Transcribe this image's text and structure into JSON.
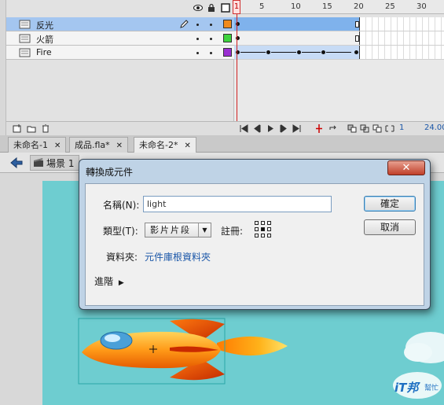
{
  "timeline": {
    "frame_numbers": [
      "1",
      "5",
      "10",
      "15",
      "20",
      "25",
      "30"
    ],
    "layers": [
      {
        "name": "反光",
        "color": "#f08a1c",
        "selected": true
      },
      {
        "name": "火箭",
        "color": "#3ed33e",
        "selected": false
      },
      {
        "name": "Fire",
        "color": "#9a2fd2",
        "selected": false
      }
    ],
    "current_frame": "1",
    "fps": "24.00"
  },
  "tabs": [
    {
      "label": "未命名-1",
      "active": false
    },
    {
      "label": "成品.fla*",
      "active": false
    },
    {
      "label": "未命名-2*",
      "active": true
    }
  ],
  "edit_bar": {
    "scene_label": "場景 1"
  },
  "dialog": {
    "title": "轉換成元件",
    "name_label": "名稱(N):",
    "name_value": "light",
    "type_label": "類型(T):",
    "type_value": "影片片段",
    "registration_label": "註冊:",
    "folder_label": "資料夾:",
    "folder_value": "元件庫根資料夾",
    "advanced_label": "進階",
    "ok_label": "確定",
    "cancel_label": "取消"
  },
  "watermark": {
    "line1": "iT邦",
    "line2": "幫忙"
  },
  "colors": {
    "selection_blue": "#a4c6f0",
    "stage_cyan": "#6ecdd0",
    "playhead_red": "#d02020"
  }
}
